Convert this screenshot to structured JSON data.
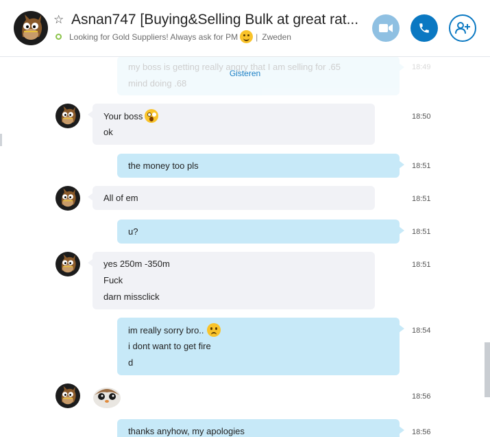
{
  "header": {
    "title": "Asnan747 [Buying&Selling Bulk at great rat...",
    "mood": "Looking for Gold Suppliers!  Always ask for PM",
    "location": "Zweden",
    "colors": {
      "accent": "#0a78c2",
      "video_button": "#8fc0e2",
      "presence": "#8bc34a"
    }
  },
  "conversation": {
    "date_separator": "Gisteren",
    "faded_message": {
      "lines": [
        "my boss is getting really angry that I am selling for .65",
        "mind doing .68"
      ],
      "time": "18:49"
    },
    "messages": [
      {
        "direction": "in",
        "lines": [
          "Your boss",
          "ok"
        ],
        "emoji": "surprised-emoji",
        "time": "18:50"
      },
      {
        "direction": "out",
        "lines": [
          "the money too pls"
        ],
        "time": "18:51"
      },
      {
        "direction": "in",
        "lines": [
          "All of em"
        ],
        "time": "18:51"
      },
      {
        "direction": "out",
        "lines": [
          "u?"
        ],
        "time": "18:51"
      },
      {
        "direction": "in",
        "lines": [
          "yes 250m -350m",
          "Fuck",
          "darn missclick"
        ],
        "time": "18:51"
      },
      {
        "direction": "out",
        "lines": [
          "im really sorry bro..",
          "i dont want to get fire",
          "d"
        ],
        "emoji": "worried-emoji",
        "time": "18:54"
      },
      {
        "direction": "in",
        "sticker": "porg-sticker-icon",
        "time": "18:56"
      },
      {
        "direction": "out",
        "lines": [
          "thanks anyhow, my apologies"
        ],
        "time": "18:56"
      }
    ]
  }
}
